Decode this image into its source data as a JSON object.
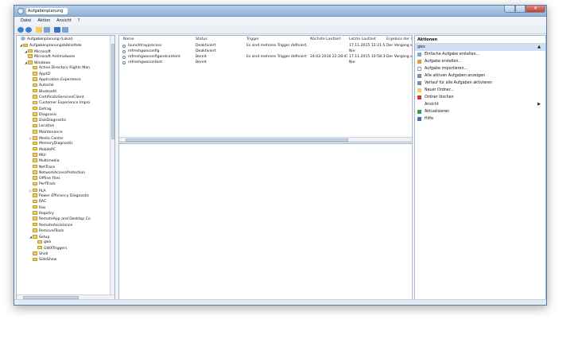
{
  "window": {
    "title": "Aufgabenplanung"
  },
  "menu": [
    "Datei",
    "Aktion",
    "Ansicht",
    "?"
  ],
  "tree": {
    "root": "Aufgabenplanung (Lokal)",
    "library": "Aufgabenplanungsbibliothek",
    "microsoft": "Microsoft",
    "items": [
      {
        "label": "Microsoft Antimalware",
        "level": 2,
        "toggle": ""
      },
      {
        "label": "Windows",
        "level": 2,
        "toggle": "◢"
      },
      {
        "label": "Active Directory Rights Man",
        "level": 3,
        "toggle": ""
      },
      {
        "label": "AppID",
        "level": 3,
        "toggle": ""
      },
      {
        "label": "Application Experience",
        "level": 3,
        "toggle": ""
      },
      {
        "label": "Autochk",
        "level": 3,
        "toggle": ""
      },
      {
        "label": "Bluetooth",
        "level": 3,
        "toggle": ""
      },
      {
        "label": "CertificateServicesClient",
        "level": 3,
        "toggle": ""
      },
      {
        "label": "Customer Experience Impro",
        "level": 3,
        "toggle": ""
      },
      {
        "label": "Defrag",
        "level": 3,
        "toggle": ""
      },
      {
        "label": "Diagnosis",
        "level": 3,
        "toggle": ""
      },
      {
        "label": "DiskDiagnostic",
        "level": 3,
        "toggle": ""
      },
      {
        "label": "Location",
        "level": 3,
        "toggle": ""
      },
      {
        "label": "Maintenance",
        "level": 3,
        "toggle": ""
      },
      {
        "label": "Media Center",
        "level": 3,
        "toggle": "▷"
      },
      {
        "label": "MemoryDiagnostic",
        "level": 3,
        "toggle": ""
      },
      {
        "label": "MobilePC",
        "level": 3,
        "toggle": ""
      },
      {
        "label": "MUI",
        "level": 3,
        "toggle": ""
      },
      {
        "label": "Multimedia",
        "level": 3,
        "toggle": ""
      },
      {
        "label": "NetTrace",
        "level": 3,
        "toggle": ""
      },
      {
        "label": "NetworkAccessProtection",
        "level": 3,
        "toggle": ""
      },
      {
        "label": "Offline Files",
        "level": 3,
        "toggle": ""
      },
      {
        "label": "PerfTrack",
        "level": 3,
        "toggle": ""
      },
      {
        "label": "PLA",
        "level": 3,
        "toggle": "▷"
      },
      {
        "label": "Power Efficiency Diagnostic",
        "level": 3,
        "toggle": ""
      },
      {
        "label": "RAC",
        "level": 3,
        "toggle": ""
      },
      {
        "label": "Ras",
        "level": 3,
        "toggle": ""
      },
      {
        "label": "Registry",
        "level": 3,
        "toggle": ""
      },
      {
        "label": "RemoteApp and Desktop Co",
        "level": 3,
        "toggle": ""
      },
      {
        "label": "RemoteAssistance",
        "level": 3,
        "toggle": ""
      },
      {
        "label": "RemovalTools",
        "level": 3,
        "toggle": ""
      },
      {
        "label": "Setup",
        "level": 3,
        "toggle": "◢"
      },
      {
        "label": "gwx",
        "level": 4,
        "toggle": ""
      },
      {
        "label": "GWXTriggers",
        "level": 4,
        "toggle": ""
      },
      {
        "label": "Shell",
        "level": 3,
        "toggle": ""
      },
      {
        "label": "SideShow",
        "level": 3,
        "toggle": ""
      }
    ]
  },
  "list": {
    "columns": [
      "Name",
      "Status",
      "Trigger",
      "Nächste Laufzeit",
      "Letzte Laufzeit",
      "Ergebnis der letzten"
    ],
    "rows": [
      {
        "name": "launchtrayprocess",
        "status": "Deaktiviert",
        "trigger": "Es sind mehrere Trigger definiert.",
        "next": "",
        "last": "17.11.2015 12:21:54",
        "result": "Der Vorgang wurde"
      },
      {
        "name": "refreshgwxconfig",
        "status": "Deaktiviert",
        "trigger": "",
        "next": "",
        "last": "Nie",
        "result": ""
      },
      {
        "name": "refreshgwxconfigandcontent",
        "status": "Bereit",
        "trigger": "Es sind mehrere Trigger definiert.",
        "next": "24.02.2016 22:28:41",
        "last": "17.11.2015 10:58:30",
        "result": "Der Vorgang wurde"
      },
      {
        "name": "refreshgwxcontent",
        "status": "Bereit",
        "trigger": "",
        "next": "",
        "last": "Nie",
        "result": ""
      }
    ]
  },
  "actions": {
    "title": "Aktionen",
    "selected": "gwx",
    "items": [
      {
        "label": "Einfache Aufgabe erstellen...",
        "icon": "wizard-icon",
        "color": "#7aa7d8"
      },
      {
        "label": "Aufgabe erstellen...",
        "icon": "task-icon",
        "color": "#e0a13a"
      },
      {
        "label": "Aufgabe importieren...",
        "icon": "import-icon",
        "color": ""
      },
      {
        "label": "Alle aktiven Aufgaben anzeigen",
        "icon": "list-icon",
        "color": "#6f8fb5"
      },
      {
        "label": "Verlauf für alle Aufgaben aktivieren",
        "icon": "history-icon",
        "color": "#6f8fb5"
      },
      {
        "label": "Neuer Ordner...",
        "icon": "folder-icon",
        "color": "#f3cd5a"
      },
      {
        "label": "Ordner löschen",
        "icon": "delete-icon",
        "color": "#d9362a"
      },
      {
        "label": "Ansicht",
        "icon": "",
        "color": "",
        "submenu": true
      },
      {
        "label": "Aktualisieren",
        "icon": "refresh-icon",
        "color": "#3c9a4a"
      },
      {
        "label": "Hilfe",
        "icon": "help-icon",
        "color": "#3b73c4"
      }
    ]
  }
}
